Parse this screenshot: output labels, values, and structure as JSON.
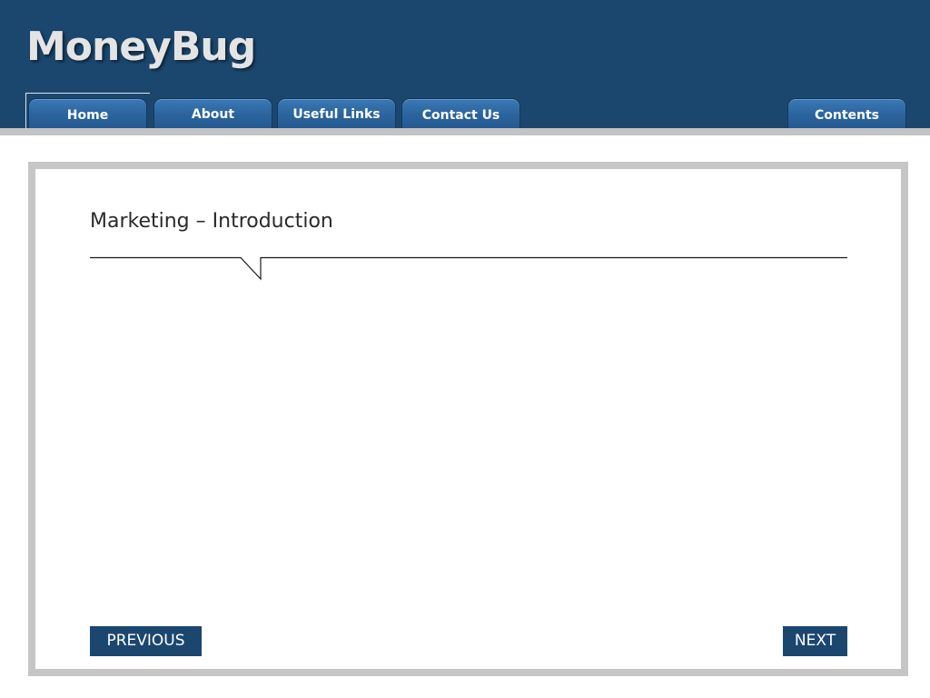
{
  "app": {
    "brand": "MoneyBug"
  },
  "nav": {
    "tabs": [
      {
        "label": "Home",
        "active": true
      },
      {
        "label": "About"
      },
      {
        "label": "Useful Links"
      },
      {
        "label": "Contact Us"
      }
    ],
    "contents_label": "Contents"
  },
  "slide": {
    "title": "Marketing – Introduction"
  },
  "footer": {
    "previous_label": "PREVIOUS",
    "next_label": "NEXT"
  },
  "colors": {
    "header_bg": "#1b476f",
    "tab_bg": "#2b649d",
    "frame_border": "#c6c6c6",
    "button_bg": "#1b476f"
  }
}
